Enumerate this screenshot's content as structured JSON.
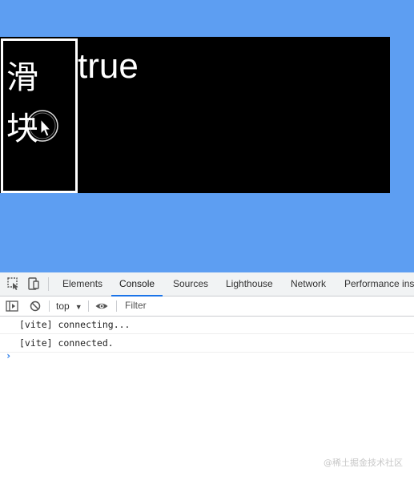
{
  "demo": {
    "slider_text": "滑块",
    "state_value": "true"
  },
  "devtools": {
    "tabs": [
      "Elements",
      "Console",
      "Sources",
      "Lighthouse",
      "Network",
      "Performance insi"
    ],
    "active_tab": "Console",
    "toolbar": {
      "context": "top",
      "filter_placeholder": "Filter"
    },
    "console_messages": [
      "[vite] connecting...",
      "[vite] connected."
    ],
    "prompt_symbol": "›",
    "icons": {
      "inspect": "inspect-element-icon",
      "device": "device-toolbar-icon",
      "sidebar": "show-sidebar-icon",
      "clear": "clear-console-icon",
      "eye": "live-expression-icon"
    }
  },
  "watermark": "@稀土掘金技术社区",
  "colors": {
    "page_background": "#5d9ef2",
    "stage_background": "#000000",
    "accent": "#1a73e8"
  }
}
